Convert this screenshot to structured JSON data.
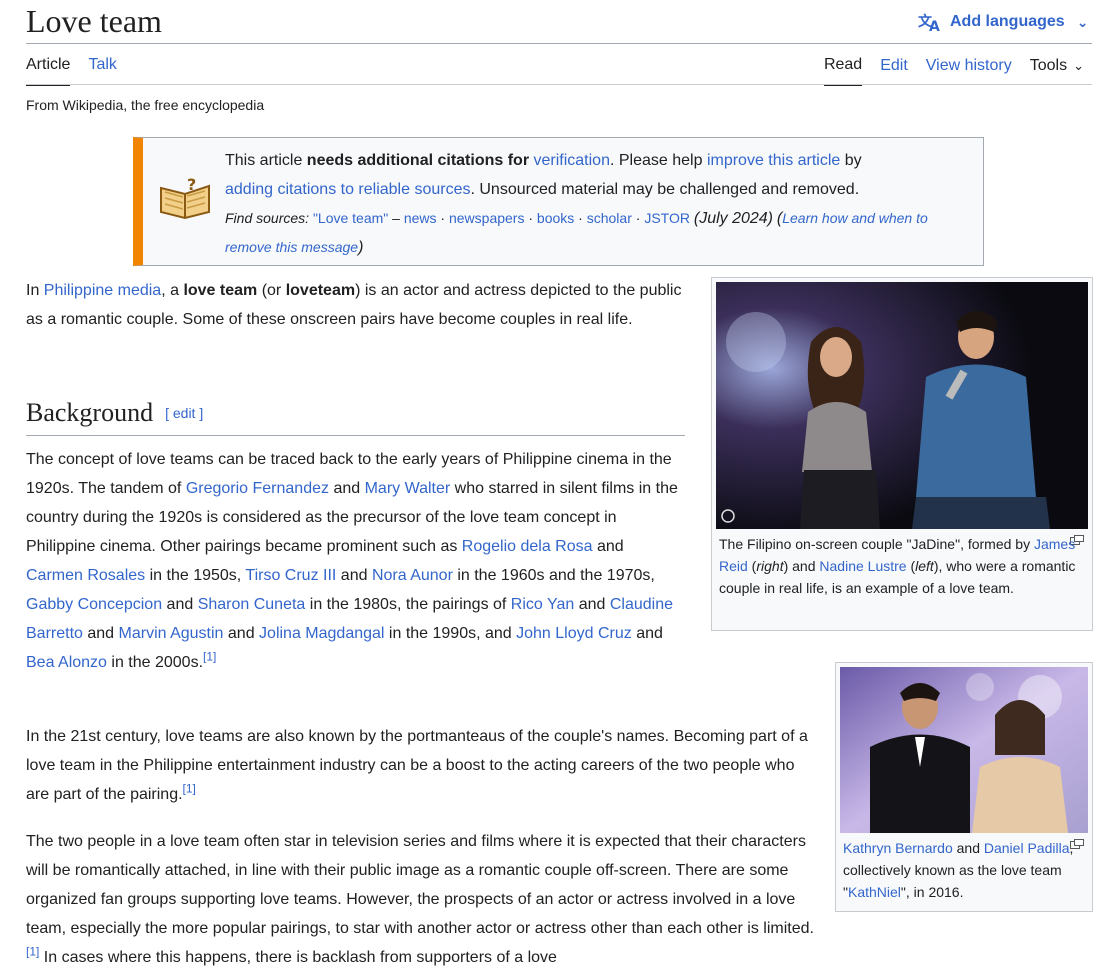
{
  "header": {
    "title": "Love team",
    "add_languages": "Add languages",
    "tabs_left": [
      "Article",
      "Talk"
    ],
    "tabs_right": [
      "Read",
      "Edit",
      "View history",
      "Tools"
    ],
    "tagline": "From Wikipedia, the free encyclopedia"
  },
  "ambox": {
    "line1_a": "This article ",
    "line1_b": "needs additional citations for ",
    "line1_link1": "verification",
    "line1_c": ". Please help ",
    "line1_link2": "improve this article",
    "line1_d": " by",
    "line2_link": "adding citations to reliable sources",
    "line2_rest": ". Unsourced material may be challenged and removed.",
    "find_label": "Find sources:",
    "find_query": "\"Love team\"",
    "find_dash": " – ",
    "find_news": "news",
    "find_newspapers": "newspapers",
    "find_books": "books",
    "find_scholar": "scholar",
    "find_jstor": "JSTOR",
    "find_date": "(July 2024)",
    "learn_open": "(",
    "learn_link": "Learn how and when to remove this message",
    "learn_close": ")"
  },
  "intro": {
    "t1": "In ",
    "l1": "Philippine media",
    "t2": ", a ",
    "b1": "love team",
    "t3": " (or ",
    "b2": "loveteam",
    "t4": ") is an actor and actress depicted to the public as a romantic couple. Some of these onscreen pairs have become couples in real life."
  },
  "background": {
    "heading": "Background",
    "edit": "[ edit ]",
    "p1": {
      "t1": "The concept of love teams can be traced back to the early years of Philippine cinema in the 1920s. The tandem of ",
      "l1": "Gregorio Fernandez",
      "t2": " and ",
      "l2": "Mary Walter",
      "t3": " who starred in silent films in the country during the 1920s is considered as the precursor of the love team concept in Philippine cinema. Other pairings became prominent such as ",
      "l3": "Rogelio dela Rosa",
      "t4": " and ",
      "l4": "Carmen Rosales",
      "t5": " in the 1950s, ",
      "l5": "Tirso Cruz III",
      "t6": " and ",
      "l6": "Nora Aunor",
      "t7": " in the 1960s and the 1970s, ",
      "l7": "Gabby Concepcion",
      "t8": " and ",
      "l8": "Sharon Cuneta",
      "t9": " in the 1980s, the pairings of ",
      "l9": "Rico Yan",
      "t10": " and ",
      "l10": "Claudine Barretto",
      "t11": " and ",
      "l11": "Marvin Agustin",
      "t12": " and ",
      "l12": "Jolina Magdangal",
      "t13": " in the 1990s, and ",
      "l13": "John Lloyd Cruz",
      "t14": " and ",
      "l14": "Bea Alonzo",
      "t15": " in the 2000s.",
      "ref": "[1]"
    },
    "p2": {
      "text": "In the 21st century, love teams are also known by the portmanteaus of the couple's names. Becoming part of a love team in the Philippine entertainment industry can be a boost to the acting careers of the two people who are part of the pairing.",
      "ref": "[1]"
    },
    "p3": {
      "text": "The two people in a love team often star in television series and films where it is expected that their characters will be romantically attached, in line with their public image as a romantic couple off-screen. There are some organized fan groups supporting love teams. However, the prospects of an actor or actress involved in a love team, especially the more popular pairings, to star with another actor or actress other than each other is limited.",
      "ref": "[1]",
      "tail": " In cases where this happens, there is backlash from supporters of a love"
    }
  },
  "figures": [
    {
      "cap_t1": "The Filipino on-screen couple \"JaDine\", formed by ",
      "cap_l1": "James Reid",
      "cap_t2": " (",
      "cap_i1": "right",
      "cap_t3": ") and ",
      "cap_l2": "Nadine Lustre",
      "cap_t4": " (",
      "cap_i2": "left",
      "cap_t5": "), who were a romantic couple in real life, is an example of a love team."
    },
    {
      "cap_l1": "Kathryn Bernardo",
      "cap_t1": " and ",
      "cap_l2": "Daniel Padilla",
      "cap_t2": ", collectively known as the love team \"",
      "cap_l3": "KathNiel",
      "cap_t3": "\", in 2016."
    }
  ],
  "colors": {
    "link": "#3366cc",
    "ambox_stripe": "#f28500",
    "text": "#202122"
  }
}
